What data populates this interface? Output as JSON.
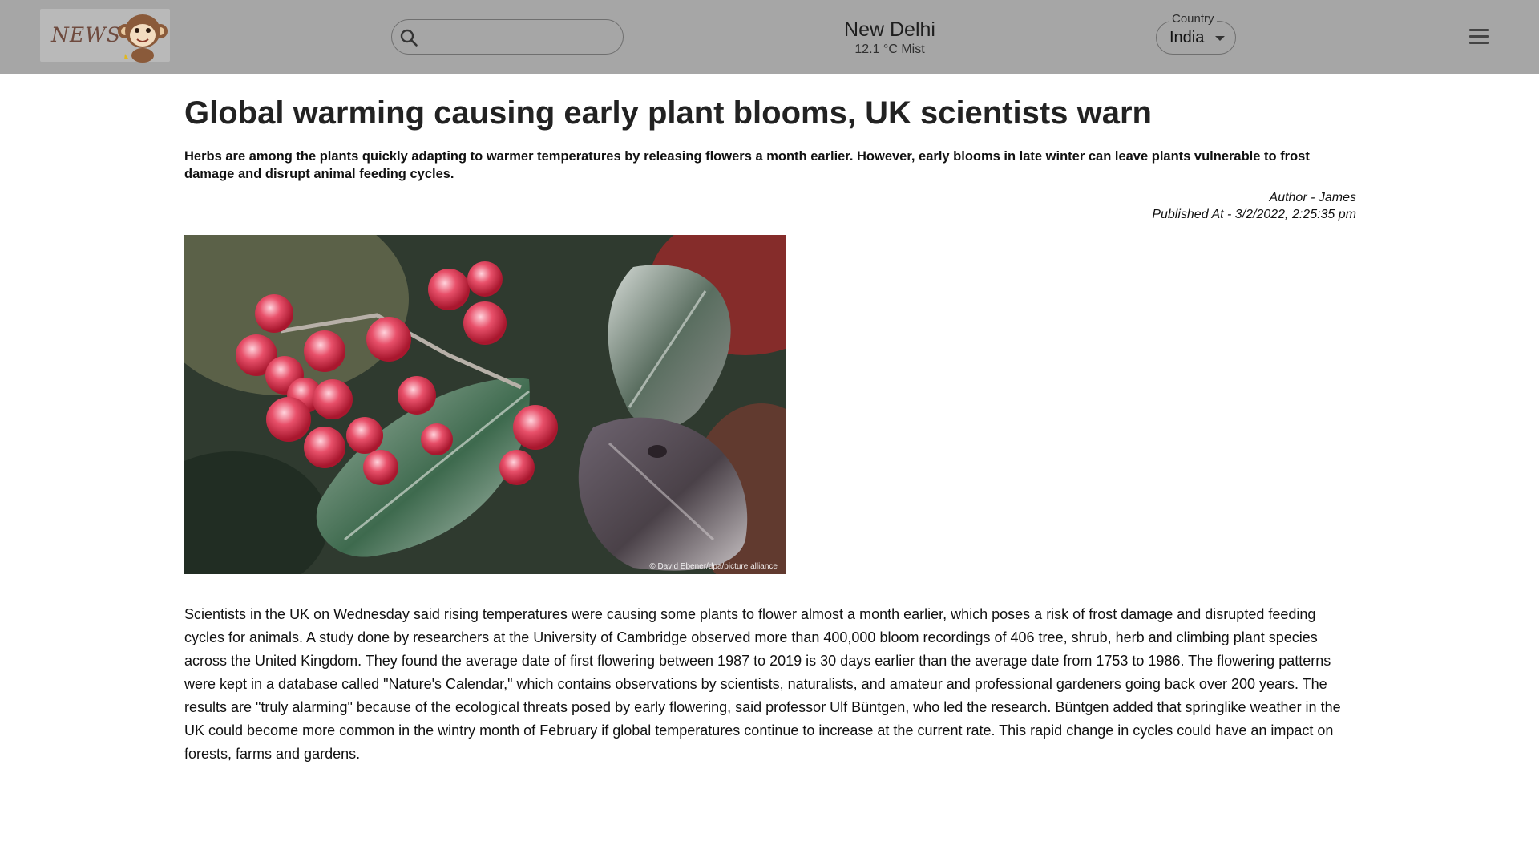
{
  "header": {
    "logo_text": "NEWS",
    "search": {
      "placeholder": "",
      "value": ""
    },
    "weather": {
      "city": "New Delhi",
      "info": "12.1 °C Mist"
    },
    "country": {
      "label": "Country",
      "value": "India"
    }
  },
  "article": {
    "title": "Global warming causing early plant blooms, UK scientists warn",
    "summary": "Herbs are among the plants quickly adapting to warmer temperatures by releasing flowers a month earlier. However, early blooms in late winter can leave plants vulnerable to frost damage and disrupt animal feeding cycles.",
    "author": "Author - James",
    "published": "Published At - 3/2/2022, 2:25:35 pm",
    "image_credit": "© David Ebener/dpa/picture alliance",
    "body": "Scientists in the UK on Wednesday said rising temperatures were causing some plants to flower almost a month earlier, which poses a risk of frost damage and disrupted feeding cycles for animals. A study done by researchers at the University of Cambridge observed more than 400,000 bloom recordings of 406 tree, shrub, herb and climbing plant species across the United Kingdom. They found the average date of first flowering between 1987 to 2019 is 30 days earlier than the average date from 1753 to 1986. The flowering patterns were kept in a database called \"Nature's Calendar,\" which contains observations by scientists, naturalists, and amateur and professional gardeners going back over 200 years. The results are \"truly alarming\" because of the ecological threats posed by early flowering, said professor Ulf Büntgen, who led the research. Büntgen added that springlike weather in the UK could become more common in the wintry month of February if global temperatures continue to increase at the current rate. This rapid change in cycles could have an impact on forests, farms and gardens."
  },
  "icons": {
    "logo": "monkey-mascot-icon",
    "search": "search-icon",
    "dropdown": "caret-down-icon",
    "menu": "hamburger-menu-icon"
  },
  "colors": {
    "header_bg": "#a6a6a6",
    "page_bg": "#ffffff",
    "text": "#222222"
  }
}
